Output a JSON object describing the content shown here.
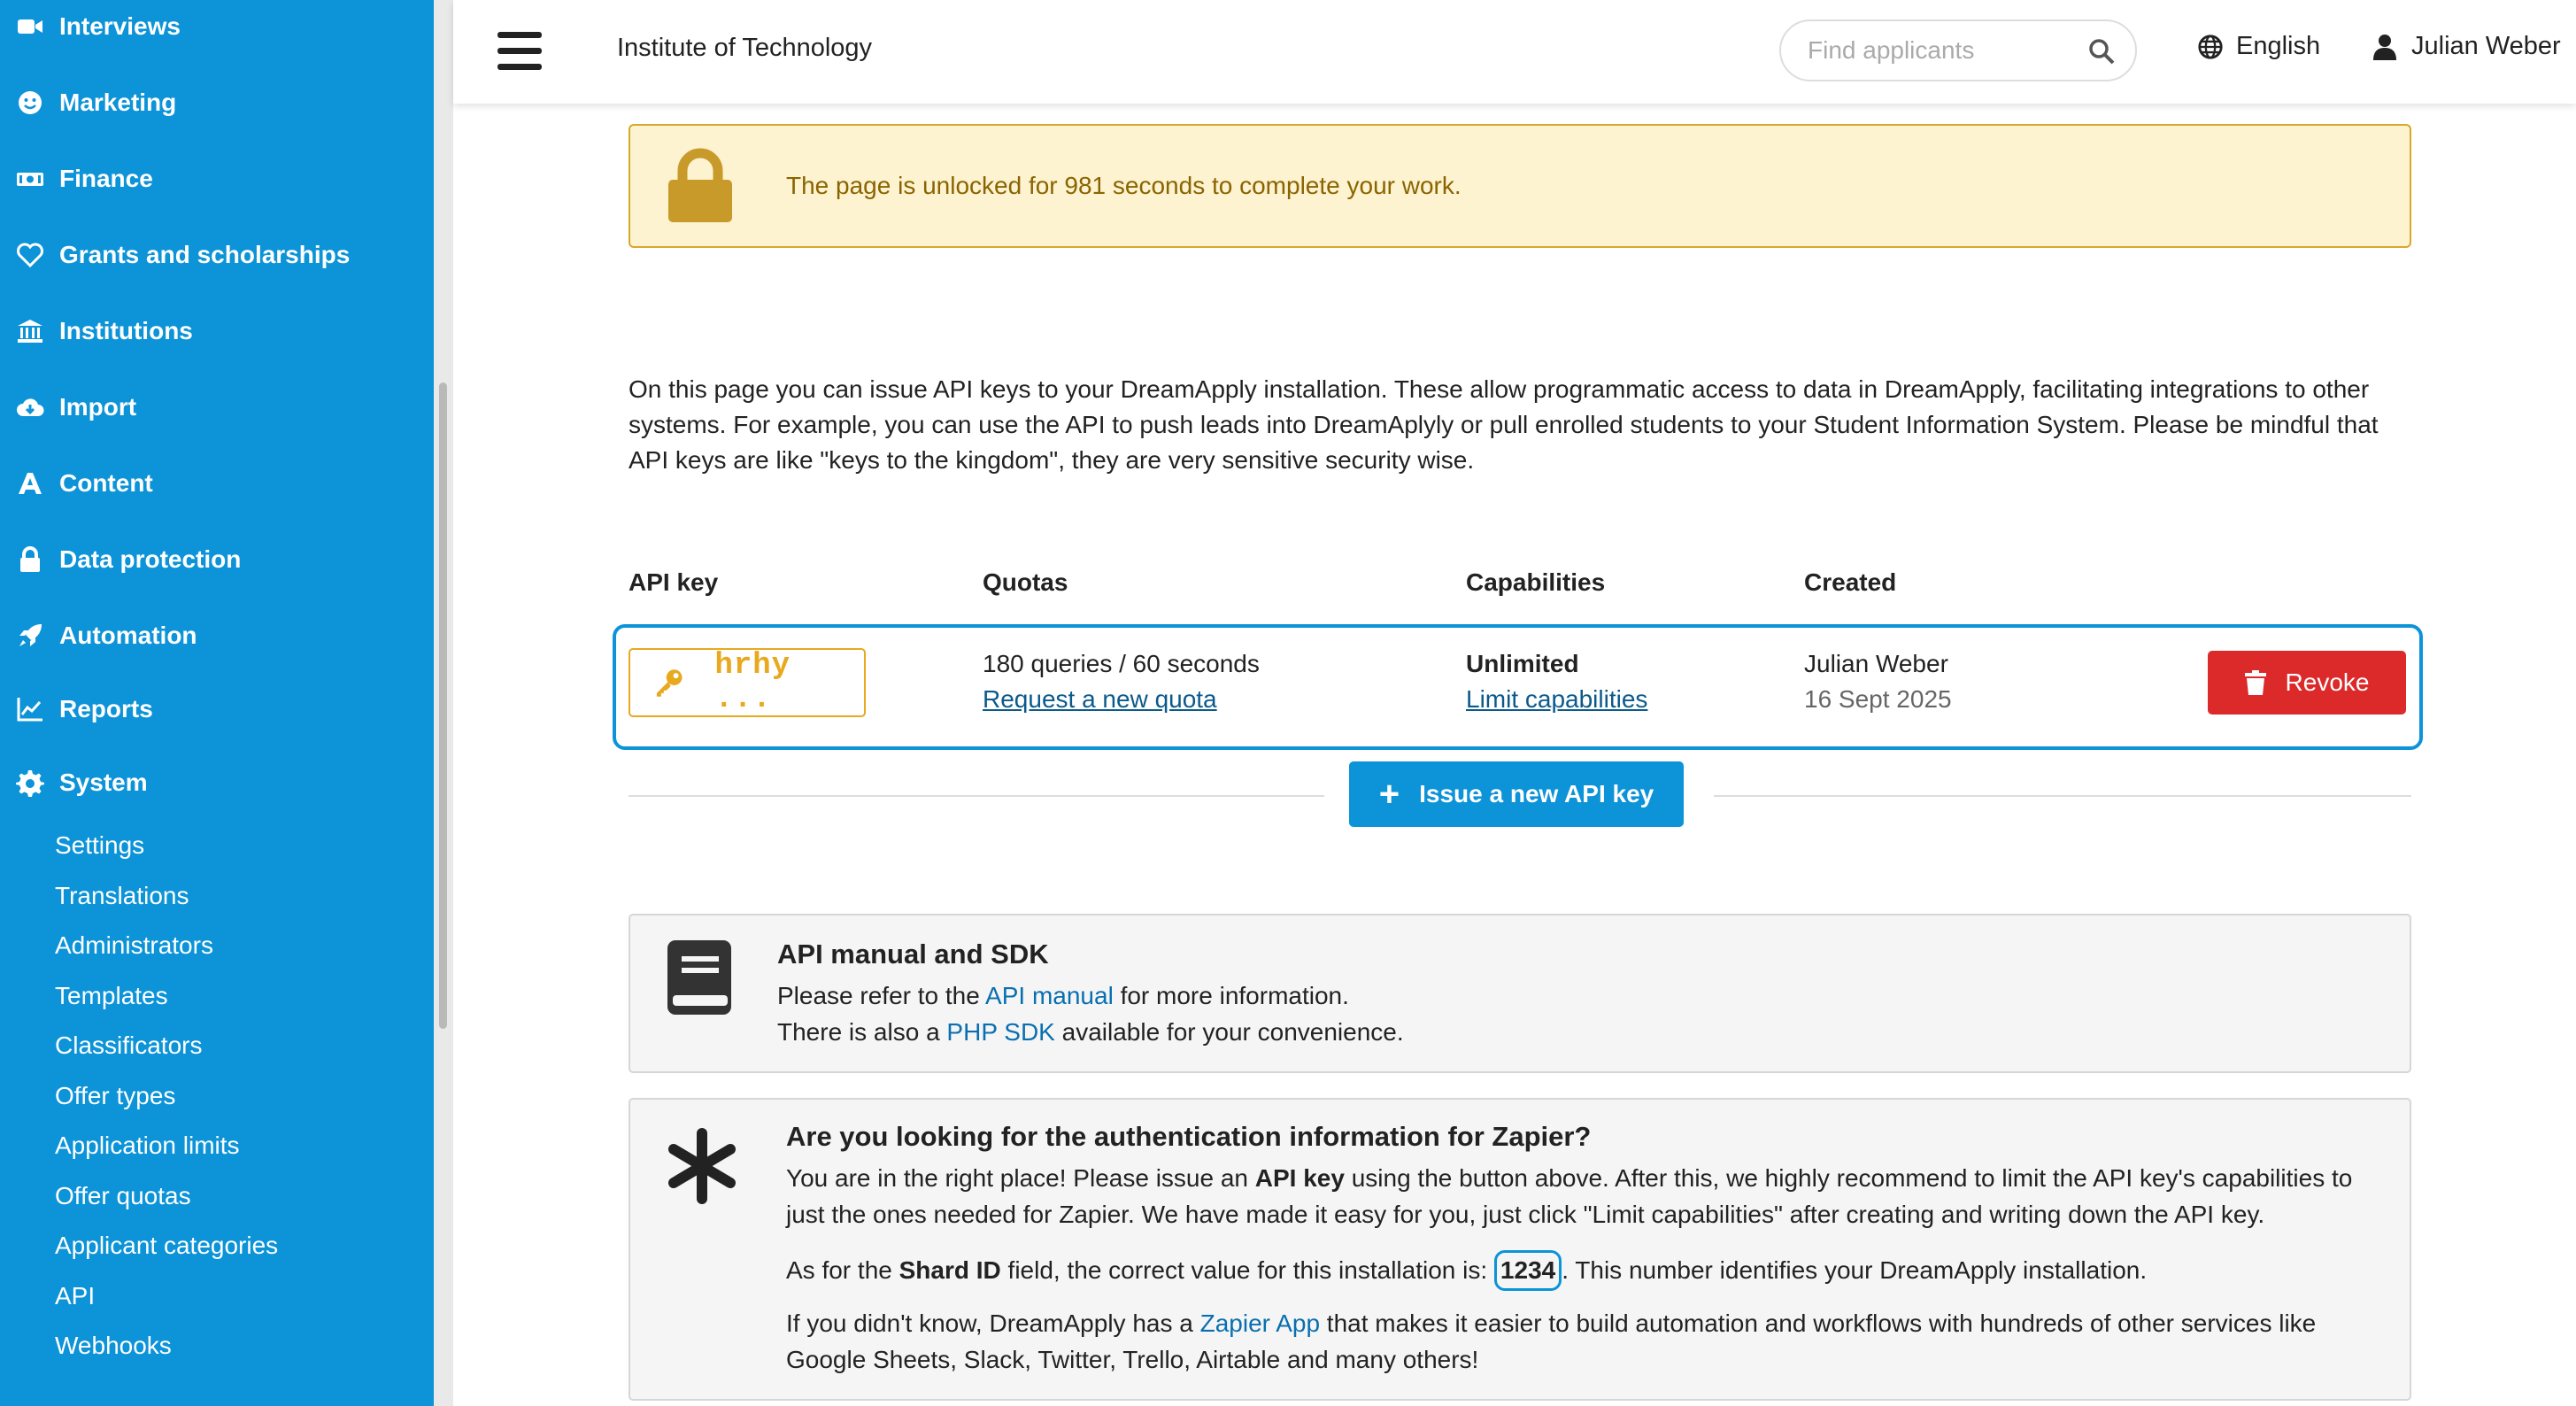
{
  "sidebar": {
    "items": [
      {
        "label": "Interviews",
        "icon": "video-camera-icon"
      },
      {
        "label": "Marketing",
        "icon": "smiley-icon"
      },
      {
        "label": "Finance",
        "icon": "banknote-icon"
      },
      {
        "label": "Grants and scholarships",
        "icon": "heart-icon"
      },
      {
        "label": "Institutions",
        "icon": "bank-building-icon"
      },
      {
        "label": "Import",
        "icon": "cloud-download-icon"
      },
      {
        "label": "Content",
        "icon": "letter-a-icon"
      },
      {
        "label": "Data protection",
        "icon": "lock-icon"
      },
      {
        "label": "Automation",
        "icon": "rocket-icon"
      },
      {
        "label": "Reports",
        "icon": "line-chart-icon"
      },
      {
        "label": "System",
        "icon": "gear-icon"
      }
    ],
    "system_items": [
      "Settings",
      "Translations",
      "Administrators",
      "Templates",
      "Classificators",
      "Offer types",
      "Application limits",
      "Offer quotas",
      "Applicant categories",
      "API",
      "Webhooks"
    ]
  },
  "header": {
    "institution": "Institute of Technology",
    "search_placeholder": "Find applicants",
    "language": "English",
    "user": "Julian Weber"
  },
  "alert": {
    "message": "The page is unlocked for 981 seconds to complete your work."
  },
  "intro": "On this page you can issue API keys to your DreamApply installation. These allow programmatic access to data in DreamApply, facilitating integrations to other systems. For example, you can use the API to push leads into DreamAplyly or pull enrolled students to your Student Information System. Please be mindful that API keys are like \"keys to the kingdom\", they are very sensitive security wise.",
  "table": {
    "headers": {
      "key": "API key",
      "quotas": "Quotas",
      "capabilities": "Capabilities",
      "created": "Created"
    },
    "row": {
      "key": "hrhy ...",
      "quota": "180 queries / 60 seconds",
      "quota_link": "Request a new quota",
      "capability": "Unlimited",
      "capability_link": "Limit capabilities",
      "created_by": "Julian Weber",
      "created_on": "16 Sept 2025",
      "revoke": "Revoke"
    },
    "issue_button": "Issue a new API key"
  },
  "manual_panel": {
    "title": "API manual and SDK",
    "line1_pre": "Please refer to the ",
    "line1_link": "API manual",
    "line1_post": " for more information.",
    "line2_pre": "There is also a ",
    "line2_link": "PHP SDK",
    "line2_post": " available for your convenience."
  },
  "zapier_panel": {
    "title": "Are you looking for the authentication information for Zapier?",
    "p1_pre": "You are in the right place! Please issue an ",
    "p1_bold": "API key",
    "p1_post": " using the button above. After this, we highly recommend to limit the API key's capabilities to just the ones needed for Zapier. We have made it easy for you, just click \"Limit capabilities\" after creating and writing down the API key.",
    "p2_pre": "As for the ",
    "p2_bold": "Shard ID",
    "p2_mid": " field, the correct value for this installation is: ",
    "shard_id": "1234",
    "p2_post": ". This number identifies your DreamApply installation.",
    "p3_pre": "If you didn't know, DreamApply has a ",
    "p3_link": "Zapier App",
    "p3_post": " that makes it easier to build automation and workflows with hundreds of other services like Google Sheets, Slack, Twitter, Trello, Airtable and many others!"
  }
}
